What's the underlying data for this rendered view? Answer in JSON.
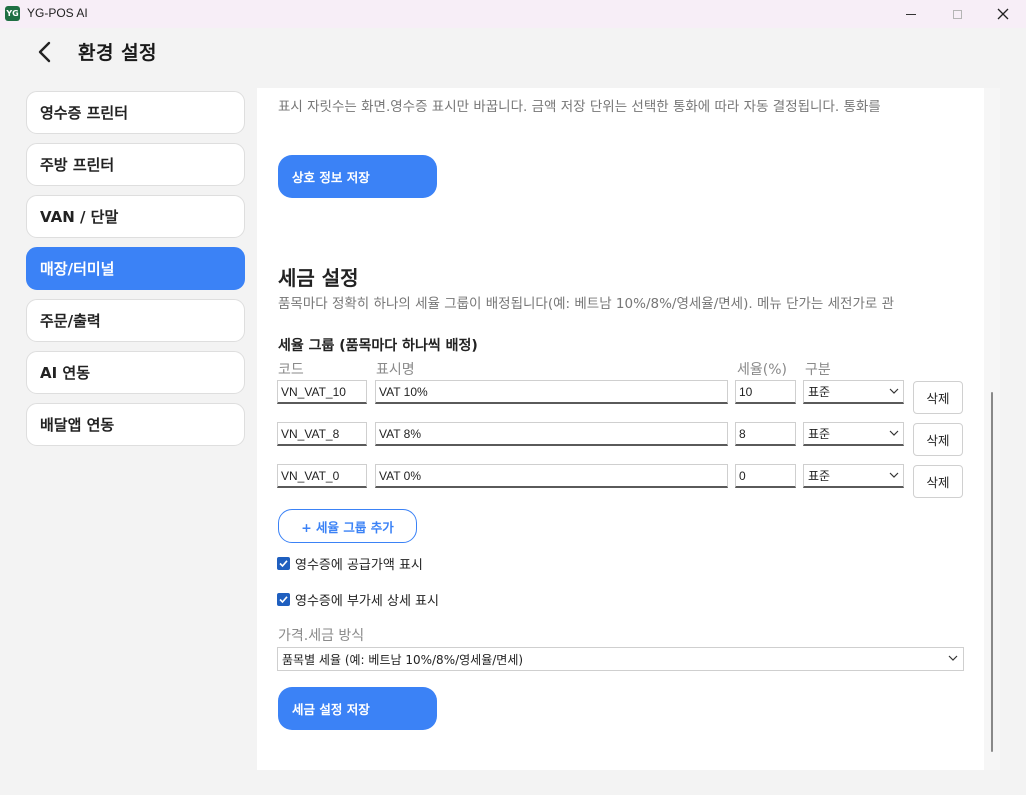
{
  "window": {
    "logo_text": "YG",
    "title": "YG-POS AI"
  },
  "header": {
    "title": "환경 설정"
  },
  "sidebar": {
    "items": [
      {
        "label": "영수증 프린터",
        "active": false
      },
      {
        "label": "주방 프린터",
        "active": false
      },
      {
        "label": "VAN / 단말",
        "active": false
      },
      {
        "label": "매장/터미널",
        "active": true
      },
      {
        "label": "주문/출력",
        "active": false
      },
      {
        "label": "AI 연동",
        "active": false
      },
      {
        "label": "배달앱 연동",
        "active": false
      }
    ]
  },
  "store": {
    "hint": "표시 자릿수는 화면.영수증 표시만 바꿉니다. 금액 저장 단위는 선택한 통화에 따라 자동 결정됩니다. 통화를",
    "save_label": "상호 정보 저장"
  },
  "tax": {
    "title": "세금 설정",
    "hint": "품목마다 정확히 하나의 세율 그룹이 배정됩니다(예: 베트남 10%/8%/영세율/면세). 메뉴 단가는 세전가로 관",
    "group_heading": "세율 그룹 (품목마다 하나씩 배정)",
    "columns": {
      "code": "코드",
      "name": "표시명",
      "rate": "세율(%)",
      "kind": "구분"
    },
    "rows": [
      {
        "code": "VN_VAT_10",
        "name": "VAT 10%",
        "rate": "10",
        "kind": "표준",
        "delete_label": "삭제"
      },
      {
        "code": "VN_VAT_8",
        "name": "VAT 8%",
        "rate": "8",
        "kind": "표준",
        "delete_label": "삭제"
      },
      {
        "code": "VN_VAT_0",
        "name": "VAT 0%",
        "rate": "0",
        "kind": "표준",
        "delete_label": "삭제"
      }
    ],
    "add_label": "+ 세율 그룹 추가",
    "checkbox_supply": {
      "label": "영수증에 공급가액 표시",
      "checked": true
    },
    "checkbox_vat": {
      "label": "영수증에 부가세 상세 표시",
      "checked": true
    },
    "method_label": "가격.세금 방식",
    "method_value": "품목별 세율 (예: 베트남 10%/8%/영세율/면세)",
    "save_label": "세금 설정 저장"
  },
  "colors": {
    "accent": "#3b82f6",
    "checkbox": "#1f5fbf"
  }
}
